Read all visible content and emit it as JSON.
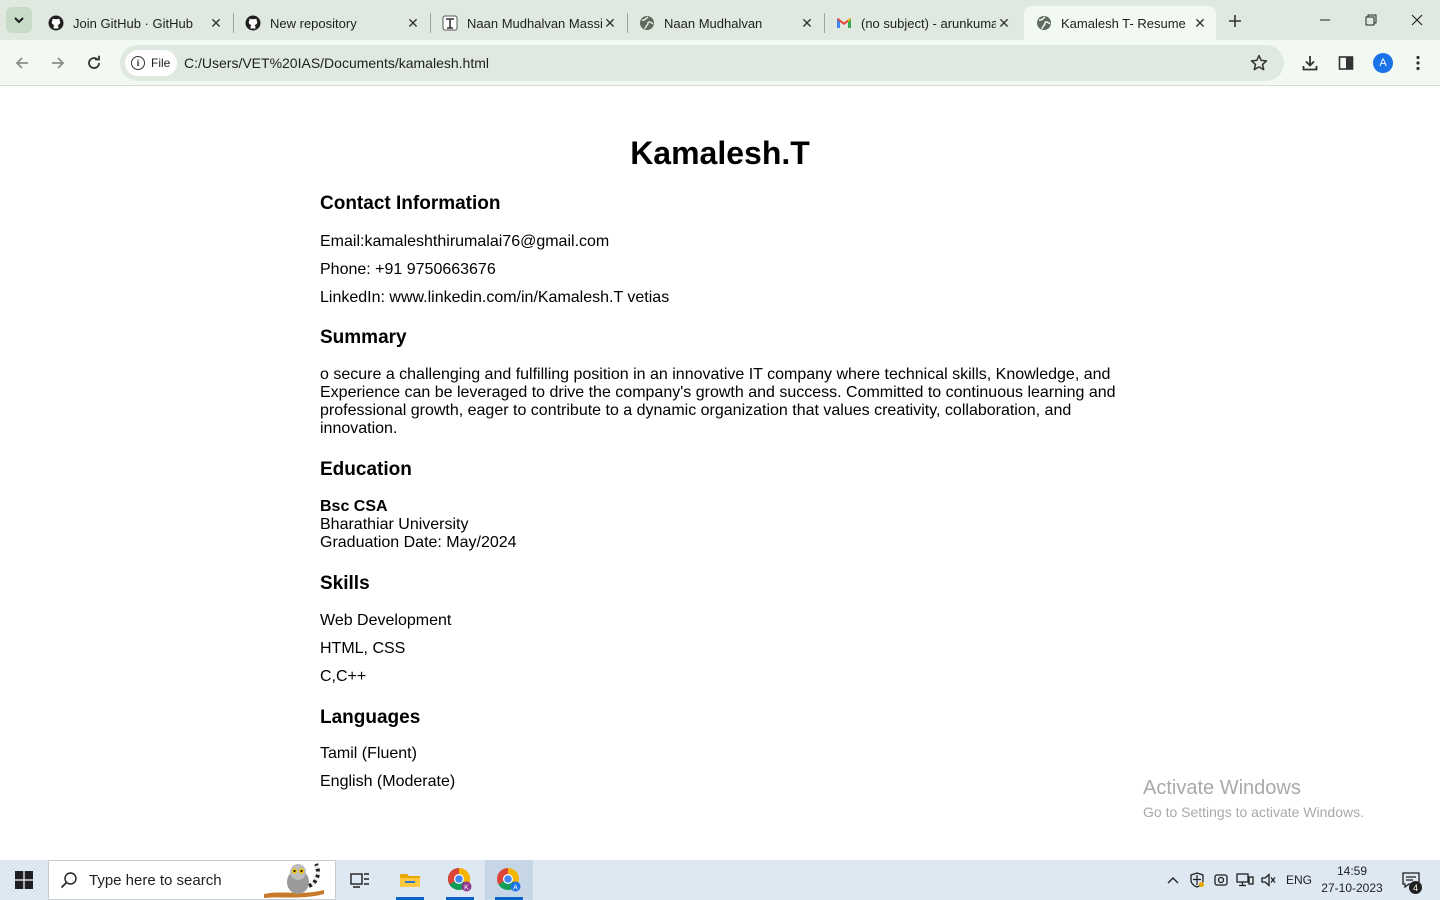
{
  "browser": {
    "tabs": [
      {
        "title": "Join GitHub · GitHub",
        "icon": "github-icon",
        "active": false
      },
      {
        "title": "New repository",
        "icon": "github-icon",
        "active": false
      },
      {
        "title": "Naan Mudhalvan Massive Open Online Course",
        "icon": "naan-mudhalvan-icon",
        "active": false
      },
      {
        "title": "Naan Mudhalvan",
        "icon": "globe-icon",
        "active": false
      },
      {
        "title": "(no subject) - arunkumar",
        "icon": "gmail-icon",
        "active": false
      },
      {
        "title": "Kamalesh T- Resume",
        "icon": "globe-icon",
        "active": true
      }
    ],
    "site_chip_label": "File",
    "url": "C:/Users/VET%20IAS/Documents/kamalesh.html",
    "profile_initial": "A"
  },
  "resume": {
    "name": "Kamalesh.T",
    "contact": {
      "heading": "Contact Information",
      "email": "Email:kamaleshthirumalai76@gmail.com",
      "phone": "Phone: +91 9750663676",
      "linkedin": "LinkedIn: www.linkedin.com/in/Kamalesh.T vetias"
    },
    "summary": {
      "heading": "Summary",
      "text": "o secure a challenging and fulfilling position in an innovative IT company where technical skills, Knowledge, and Experience can be leveraged to drive the company's growth and success. Committed to continuous learning and professional growth, eager to contribute to a dynamic organization that values creativity, collaboration, and innovation."
    },
    "education": {
      "heading": "Education",
      "degree": "Bsc CSA",
      "university": "Bharathiar University",
      "graduation": "Graduation Date: May/2024"
    },
    "skills": {
      "heading": "Skills",
      "items": [
        "Web Development",
        "HTML, CSS",
        "C,C++"
      ]
    },
    "languages": {
      "heading": "Languages",
      "items": [
        "Tamil (Fluent)",
        "English (Moderate)"
      ]
    }
  },
  "watermark": {
    "line1": "Activate Windows",
    "line2": "Go to Settings to activate Windows."
  },
  "taskbar": {
    "search_placeholder": "Type here to search",
    "language": "ENG",
    "time": "14:59",
    "date": "27-10-2023",
    "notification_count": "4"
  },
  "colors": {
    "tabstrip_bg": "#dfe9df",
    "toolbar_bg": "#f2f8f2",
    "taskbar_bg": "#dde8f2",
    "accent_blue": "#1a73e8"
  }
}
